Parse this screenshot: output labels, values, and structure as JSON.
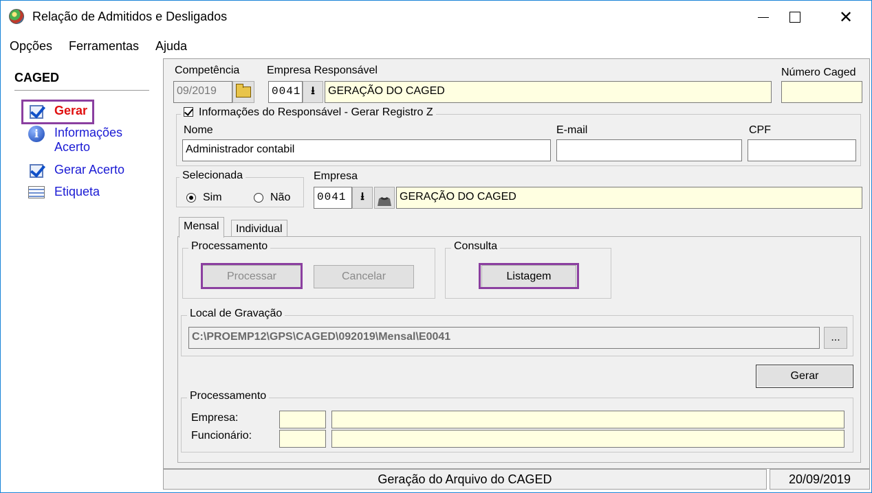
{
  "window": {
    "title": "Relação de Admitidos e Desligados"
  },
  "menu": {
    "items": [
      "Opções",
      "Ferramentas",
      "Ajuda"
    ]
  },
  "sidebar": {
    "title": "CAGED",
    "items": [
      {
        "label": "Gerar",
        "icon": "check-icon"
      },
      {
        "label": "Informações",
        "label2": "Acerto",
        "icon": "info-icon"
      },
      {
        "label": "Gerar Acerto",
        "icon": "check-icon"
      },
      {
        "label": "Etiqueta",
        "icon": "label-icon"
      }
    ]
  },
  "top": {
    "competencia_label": "Competência",
    "competencia_value": "09/2019",
    "empresa_resp_label": "Empresa Responsável",
    "empresa_resp_code": "0041",
    "empresa_resp_name": "GERAÇÃO DO CAGED",
    "numero_caged_label": "Número Caged",
    "numero_caged_value": ""
  },
  "responsavel": {
    "title": "Informações do Responsável - Gerar Registro Z",
    "checked": true,
    "nome_label": "Nome",
    "nome_value": "Administrador contabil",
    "email_label": "E-mail",
    "email_value": "",
    "cpf_label": "CPF",
    "cpf_value": ""
  },
  "selecionada": {
    "title": "Selecionada",
    "options": [
      "Sim",
      "Não"
    ],
    "selected": "Sim"
  },
  "empresa": {
    "label": "Empresa",
    "code": "0041",
    "name": "GERAÇÃO DO CAGED"
  },
  "tabs": [
    "Mensal",
    "Individual"
  ],
  "processamento_group": {
    "title": "Processamento",
    "processar_label": "Processar",
    "cancelar_label": "Cancelar"
  },
  "consulta_group": {
    "title": "Consulta",
    "listagem_label": "Listagem"
  },
  "local": {
    "title": "Local de Gravação",
    "path": "C:\\PROEMP12\\GPS\\CAGED\\092019\\Mensal\\E0041",
    "browse_label": "..."
  },
  "gerar_button": "Gerar",
  "processamento_status": {
    "title": "Processamento",
    "empresa_label": "Empresa:",
    "funcionario_label": "Funcionário:"
  },
  "statusbar": {
    "message": "Geração do Arquivo do CAGED",
    "date": "20/09/2019"
  },
  "colors": {
    "highlight": "#8b3fa0",
    "link": "#1a1ad4",
    "active_link": "#e01010",
    "field_yellow": "#ffffe1"
  }
}
